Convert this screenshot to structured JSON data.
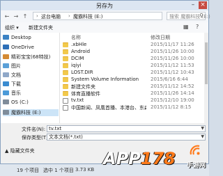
{
  "window": {
    "title": "另存为",
    "minimize_glyph": "–",
    "close_glyph": "×"
  },
  "address": {
    "back_glyph": "←",
    "forward_glyph": "→",
    "up_glyph": "↑",
    "crumbs": [
      "这台电脑",
      "魔霸科技 (E:)"
    ],
    "separator": "›",
    "search_placeholder": "搜索 魔霸科技 (E:)",
    "search_icon": "search-icon"
  },
  "toolbar": {
    "organize": "组织 ▾",
    "new_folder": "新建文件夹",
    "view_icon": "view-icon",
    "help_icon": "help-icon"
  },
  "nav": {
    "items": [
      {
        "label": "Desktop",
        "icon": "desktop-icon",
        "color": "#3b82c4"
      },
      {
        "label": "OneDrive",
        "icon": "cloud-icon",
        "color": "#2d6fb8"
      },
      {
        "label": "精彩宝宝(68特技)",
        "icon": "user-icon",
        "color": "#d48a34"
      },
      {
        "label": "图片",
        "icon": "pictures-icon",
        "color": "#5aa0d8"
      },
      {
        "label": "文档",
        "icon": "documents-icon",
        "color": "#8fa8c8"
      },
      {
        "label": "下载",
        "icon": "downloads-icon",
        "color": "#3a8bd0"
      },
      {
        "label": "音乐",
        "icon": "music-icon",
        "color": "#4b9ad8"
      },
      {
        "label": "OS (C:)",
        "icon": "drive-icon",
        "color": "#7f8c9a"
      },
      {
        "label": "魔霸科技 (E:)",
        "icon": "drive-icon",
        "color": "#7f8c9a",
        "selected": true
      }
    ]
  },
  "files": {
    "columns": {
      "name": "名称",
      "date": "修改日期"
    },
    "rows": [
      {
        "name": ".xbHle",
        "date": "2015/11/17 11:26",
        "kind": "folder"
      },
      {
        "name": "Android",
        "date": "2015/11/26 10:00",
        "kind": "folder"
      },
      {
        "name": "DCIM",
        "date": "2015/11/26 10:00",
        "kind": "folder"
      },
      {
        "name": "iqiyi",
        "date": "2015/11/12 11:53",
        "kind": "folder"
      },
      {
        "name": "LOST.DIR",
        "date": "2015/11/12 10:43",
        "kind": "folder"
      },
      {
        "name": "System Volume Information",
        "date": "2015/6/16 6:44",
        "kind": "folder"
      },
      {
        "name": "新建文件夹",
        "date": "2015/11/12 14:52",
        "kind": "folder"
      },
      {
        "name": "体育直播软件",
        "date": "2015/11/26 14:14",
        "kind": "folder"
      },
      {
        "name": "tv.txt",
        "date": "2015/12/10 19:00",
        "kind": "txt"
      },
      {
        "name": "中国新闻、凤凰首播、本港台、东森卫视...",
        "date": "2015/11/12 8:15",
        "kind": "txt"
      }
    ]
  },
  "form": {
    "filename_label": "文件名(N):",
    "filename_value": "tv.txt",
    "savetype_label": "保存类型(T):",
    "savetype_value": "文本文档(*.txt)",
    "dropdown_glyph": "▼"
  },
  "hide_folders": "隐藏文件夹",
  "status": {
    "count": "19 个项目",
    "selected": "选中 1 个项目",
    "size": "3.73 KB"
  },
  "watermark": {
    "app": "APP",
    "num": "178",
    "site": "手游网"
  }
}
